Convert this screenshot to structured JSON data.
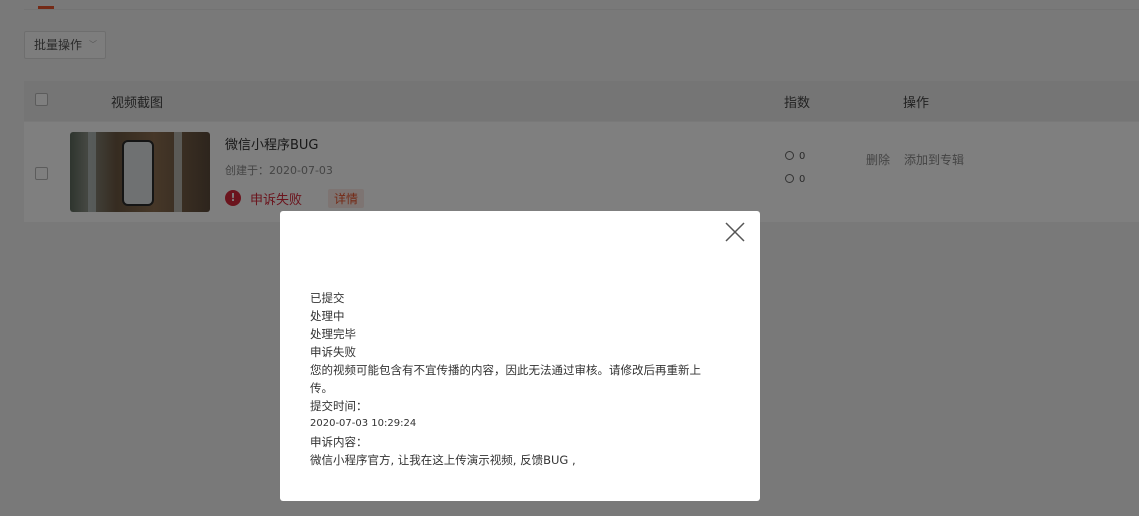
{
  "toolbar": {
    "batch_label": "批量操作"
  },
  "table": {
    "headers": {
      "thumbnail": "视频截图",
      "index": "指数",
      "actions": "操作"
    },
    "rows": [
      {
        "title": "微信小程序BUG",
        "created": "创建于：2020-07-03",
        "status": "申诉失败",
        "detail": "详情",
        "plays": "0",
        "comments": "0",
        "actions": {
          "delete": "删除",
          "add_to_album": "添加到专辑"
        }
      }
    ]
  },
  "modal": {
    "steps": [
      "已提交",
      "处理中",
      "处理完毕",
      "申诉失败"
    ],
    "message_line1": "您的视频可能包含有不宜传播的内容，因此无法通过审核。请修改后再重新上",
    "message_line2": "传。",
    "time_label": "提交时间：",
    "time_value": "2020-07-03 10:29:24",
    "content_label": "申诉内容：",
    "content_value": "微信小程序官方, 让我在这上传演示视频, 反馈BUG ,"
  },
  "colors": {
    "accent": "#e8542d",
    "error": "#d6293b",
    "overlay": "rgba(0,0,0,0.5)"
  },
  "icons": {
    "status": "exclamation-circle-icon",
    "close": "close-icon",
    "plays": "play-icon",
    "comments": "comment-icon"
  }
}
